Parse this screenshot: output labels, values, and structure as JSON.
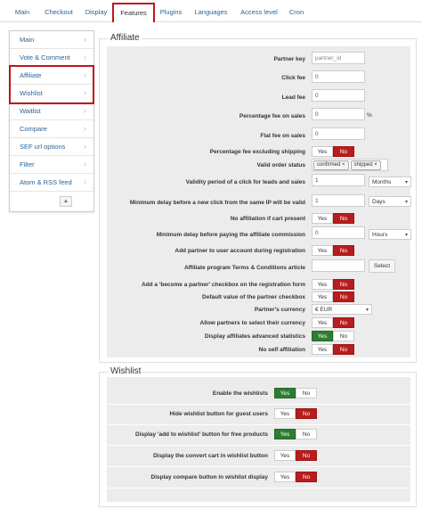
{
  "tabs": [
    "Main",
    "Checkout",
    "Display",
    "Features",
    "Plugins",
    "Languages",
    "Access level",
    "Cron"
  ],
  "sidebar": {
    "items": [
      "Main",
      "Vote & Comment",
      "Affiliate",
      "Wishlist",
      "Waitlist",
      "Compare",
      "SEF url options",
      "Filter",
      "Atom & RSS feed"
    ]
  },
  "affiliate": {
    "legend": "Affiliate",
    "partner_key_label": "Partner key",
    "partner_key_placeholder": "partner_id",
    "click_fee_label": "Click fee",
    "click_fee_value": "0",
    "lead_fee_label": "Lead fee",
    "lead_fee_value": "0",
    "pct_fee_label": "Percentage fee on sales",
    "pct_fee_value": "0",
    "pct_unit": "%",
    "flat_fee_label": "Flat fee on sales",
    "flat_fee_value": "0",
    "pct_fee_excl_label": "Percentage fee excluding shipping",
    "valid_status_label": "Valid order status",
    "status_tags": [
      "confirmed",
      "shipped"
    ],
    "validity_label": "Validity period of a click for leads and sales",
    "validity_value": "1",
    "validity_unit": "Months",
    "min_delay_ip_label": "Minimum delay before a new click from the same IP will be valid",
    "min_delay_ip_value": "1",
    "min_delay_ip_unit": "Days",
    "no_aff_cart_label": "No affiliation if cart present",
    "min_delay_pay_label": "Minimum delay before paying the affiliate commission",
    "min_delay_pay_value": "0",
    "min_delay_pay_unit": "Hours",
    "add_partner_label": "Add partner to user account during registration",
    "terms_label": "Affiliate program Terms & Conditions article",
    "select_label": "Select",
    "become_partner_label": "Add a 'become a partner' checkbox on the registration form",
    "default_checkbox_label": "Default value of the partner checkbox",
    "currency_label": "Partner's currency",
    "currency_value": "€ EUR",
    "allow_currency_label": "Allow partners to select their currency",
    "adv_stats_label": "Display affiliates advanced statistics",
    "no_self_label": "No self affiliation",
    "yes": "Yes",
    "no": "No"
  },
  "wishlist": {
    "legend": "Wishlist",
    "rows": [
      {
        "label": "Enable the wishlists",
        "state": "yes"
      },
      {
        "label": "Hide wishlist button for guest users",
        "state": "no"
      },
      {
        "label": "Display 'add to wishlist' button for free products",
        "state": "yes"
      },
      {
        "label": "Display the convert cart in wishlist button",
        "state": "no"
      },
      {
        "label": "Display compare button in wishlist display",
        "state": "no"
      }
    ]
  },
  "colors": {
    "accent": "#2a6496",
    "no_active": "#b91c1c",
    "yes_active": "#2e7d32",
    "highlight": "#c0151b"
  }
}
